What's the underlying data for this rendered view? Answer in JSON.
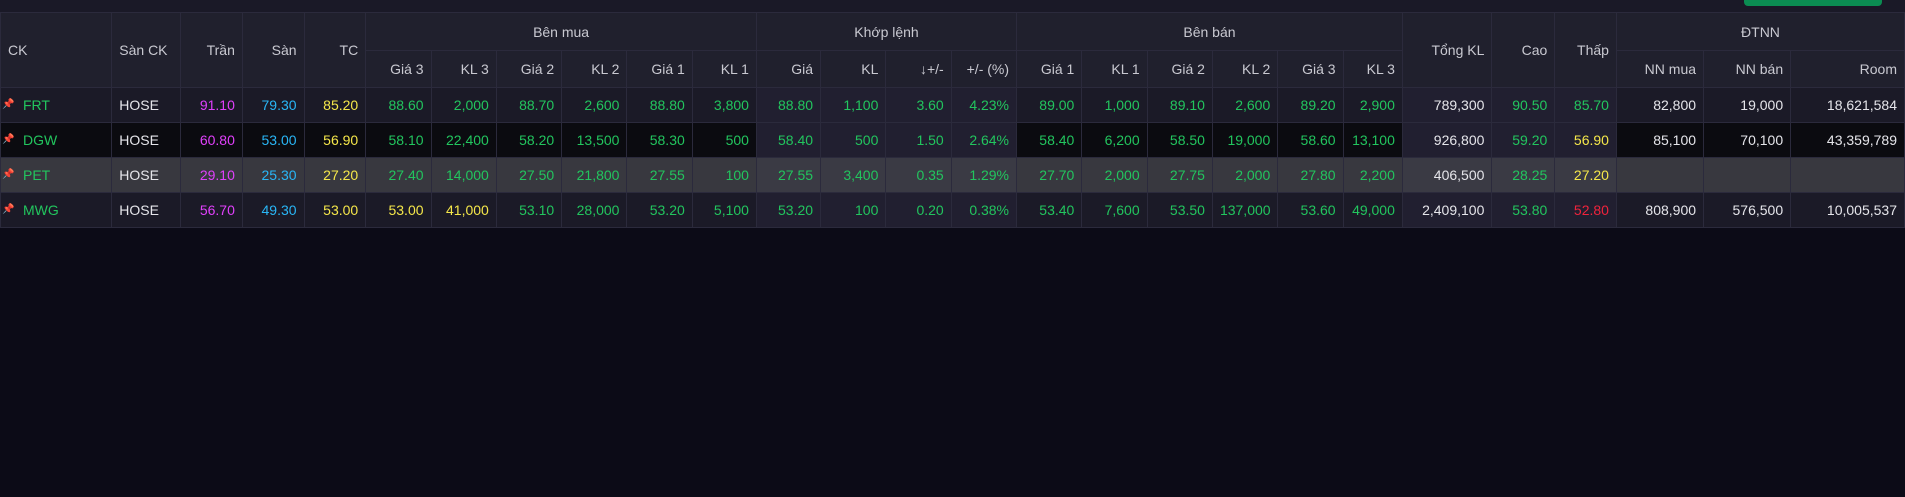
{
  "header": {
    "ck": "CK",
    "exchange": "Sàn CK",
    "ceiling": "Trần",
    "floor": "Sàn",
    "reference": "TC",
    "bid_group": "Bên mua",
    "match_group": "Khớp lệnh",
    "ask_group": "Bên bán",
    "total_volume": "Tổng KL",
    "high": "Cao",
    "low": "Thấp",
    "foreign_group": "ĐTNN",
    "bid_cols": [
      "Giá 3",
      "KL 3",
      "Giá 2",
      "KL 2",
      "Giá 1",
      "KL 1"
    ],
    "match_cols": [
      "Giá",
      "KL",
      "+/-",
      "+/- (%)"
    ],
    "ask_cols": [
      "Giá 1",
      "KL 1",
      "Giá 2",
      "KL 2",
      "Giá 3",
      "KL 3"
    ],
    "foreign_cols": [
      "NN mua",
      "NN bán",
      "Room"
    ],
    "change_sort_icon": "arrow-down-icon"
  },
  "rows": [
    {
      "symbol": "FRT",
      "exchange": "HOSE",
      "ceiling": "91.10",
      "floor": "79.30",
      "ref": "85.20",
      "bid": [
        "88.60",
        "2,000",
        "88.70",
        "2,600",
        "88.80",
        "3,800"
      ],
      "match": [
        "88.80",
        "1,100",
        "3.60",
        "4.23%"
      ],
      "ask": [
        "89.00",
        "1,000",
        "89.10",
        "2,600",
        "89.20",
        "2,900"
      ],
      "total": "789,300",
      "high": "90.50",
      "low": "85.70",
      "foreign": [
        "82,800",
        "19,000",
        "18,621,584"
      ]
    },
    {
      "symbol": "DGW",
      "exchange": "HOSE",
      "ceiling": "60.80",
      "floor": "53.00",
      "ref": "56.90",
      "bid": [
        "58.10",
        "22,400",
        "58.20",
        "13,500",
        "58.30",
        "500"
      ],
      "match": [
        "58.40",
        "500",
        "1.50",
        "2.64%"
      ],
      "ask": [
        "58.40",
        "6,200",
        "58.50",
        "19,000",
        "58.60",
        "13,100"
      ],
      "total": "926,800",
      "high": "59.20",
      "low": "56.90",
      "foreign": [
        "85,100",
        "70,100",
        "43,359,789"
      ]
    },
    {
      "symbol": "PET",
      "exchange": "HOSE",
      "ceiling": "29.10",
      "floor": "25.30",
      "ref": "27.20",
      "bid": [
        "27.40",
        "14,000",
        "27.50",
        "21,800",
        "27.55",
        "100"
      ],
      "match": [
        "27.55",
        "3,400",
        "0.35",
        "1.29%"
      ],
      "ask": [
        "27.70",
        "2,000",
        "27.75",
        "2,000",
        "27.80",
        "2,200"
      ],
      "total": "406,500",
      "high": "28.25",
      "low": "27.20",
      "foreign": [
        "",
        "",
        ""
      ]
    },
    {
      "symbol": "MWG",
      "exchange": "HOSE",
      "ceiling": "56.70",
      "floor": "49.30",
      "ref": "53.00",
      "bid": [
        "53.00",
        "41,000",
        "53.10",
        "28,000",
        "53.20",
        "5,100"
      ],
      "match": [
        "53.20",
        "100",
        "0.20",
        "0.38%"
      ],
      "ask": [
        "53.40",
        "7,600",
        "53.50",
        "137,000",
        "53.60",
        "49,000"
      ],
      "total": "2,409,100",
      "high": "53.80",
      "low": "52.80",
      "foreign": [
        "808,900",
        "576,500",
        "10,005,537"
      ]
    }
  ],
  "colors": {
    "up": "#22c55e",
    "down": "#ef233c",
    "ceiling": "#e040fb",
    "floor": "#29b6f6",
    "reference": "#f5e74a",
    "highlight_row": "#38383f"
  }
}
